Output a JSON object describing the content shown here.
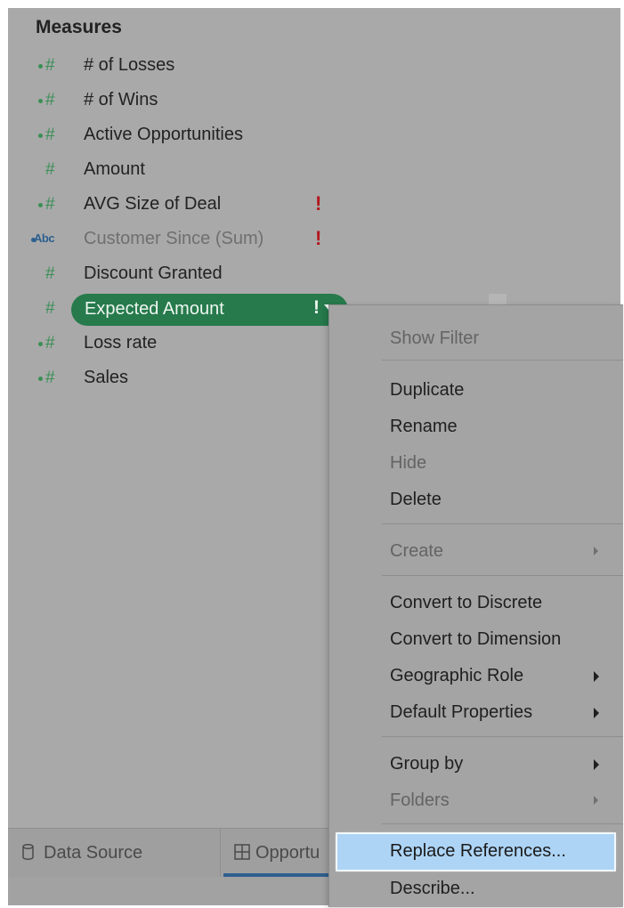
{
  "measures": {
    "title": "Measures",
    "fields": [
      {
        "name": "# of Losses",
        "icon": "hash-icon",
        "dot": true,
        "warning": ""
      },
      {
        "name": "# of Wins",
        "icon": "hash-icon",
        "dot": true,
        "warning": ""
      },
      {
        "name": "Active Opportunities",
        "icon": "hash-icon",
        "dot": true,
        "warning": ""
      },
      {
        "name": "Amount",
        "icon": "hash-icon",
        "dot": false,
        "warning": ""
      },
      {
        "name": "AVG Size of Deal",
        "icon": "hash-icon",
        "dot": true,
        "warning": "!"
      },
      {
        "name": "Customer Since (Sum)",
        "icon": "abc-icon",
        "icon_text": "Abc",
        "dot": true,
        "warning": "!"
      },
      {
        "name": "Discount Granted",
        "icon": "hash-icon",
        "dot": false,
        "warning": ""
      },
      {
        "name": "Expected Amount",
        "icon": "hash-icon",
        "dot": false,
        "warning": "!",
        "selected": true
      },
      {
        "name": "Loss rate",
        "icon": "hash-icon",
        "dot": true,
        "warning": ""
      },
      {
        "name": "Sales",
        "icon": "hash-icon",
        "dot": true,
        "warning": ""
      }
    ]
  },
  "tabs": [
    {
      "label": "Data Source",
      "icon": "database-icon"
    },
    {
      "label": "Opportu",
      "icon": "grid-icon"
    }
  ],
  "context_menu": {
    "items": [
      {
        "label": "Show Filter",
        "enabled": false
      },
      {
        "label": "Duplicate",
        "enabled": true
      },
      {
        "label": "Rename",
        "enabled": true
      },
      {
        "label": "Hide",
        "enabled": false
      },
      {
        "label": "Delete",
        "enabled": true
      },
      {
        "label": "Create",
        "enabled": false,
        "submenu": true
      },
      {
        "label": "Convert to Discrete",
        "enabled": true
      },
      {
        "label": "Convert to Dimension",
        "enabled": true
      },
      {
        "label": "Geographic Role",
        "enabled": true,
        "submenu": true
      },
      {
        "label": "Default Properties",
        "enabled": true,
        "submenu": true
      },
      {
        "label": "Group by",
        "enabled": true,
        "submenu": true
      },
      {
        "label": "Folders",
        "enabled": false,
        "submenu": true
      },
      {
        "label": "Replace References...",
        "enabled": true,
        "highlighted": true
      },
      {
        "label": "Describe...",
        "enabled": true
      }
    ]
  },
  "colors": {
    "measure_green": "#3a8f56",
    "pill_green": "#267a4c",
    "warning_red": "#b2171d",
    "highlight_blue": "#aed4f5",
    "active_tab_underline": "#2f5f8f"
  }
}
